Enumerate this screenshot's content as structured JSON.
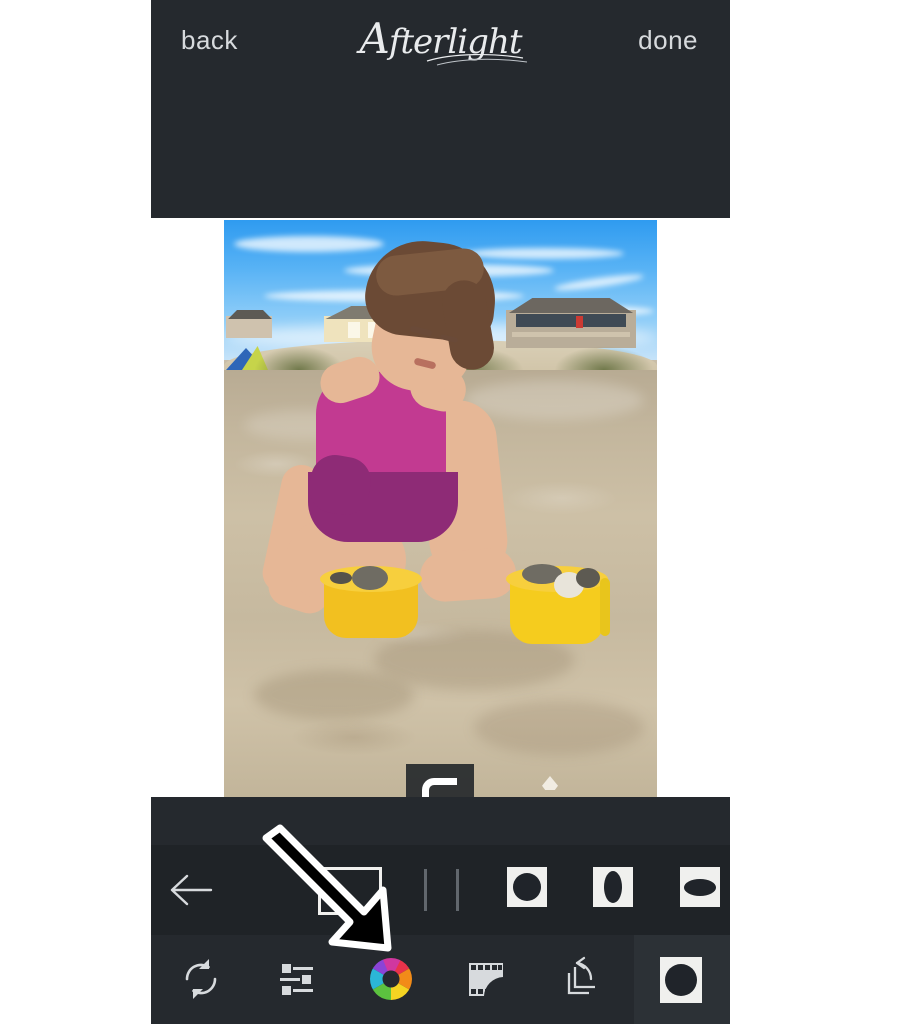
{
  "app": {
    "name": "Afterlight",
    "brand_cap": "A",
    "brand_rest": "fterlight"
  },
  "header": {
    "back_label": "back",
    "done_label": "done",
    "title": "Afterlight",
    "background_color": "#25292e",
    "text_color": "#d7dadd"
  },
  "photo": {
    "alt": "young girl in purple swimsuit crouching on wet sand beach with two yellow buckets of shells",
    "scene": {
      "sky": "blue sky with wispy white clouds",
      "background": "beach houses on dunes, blue and yellow tent at left",
      "subject": "girl with braided updo hair in magenta ruffled swimsuit",
      "foreground": "wet sand with two yellow sand buckets holding shells"
    }
  },
  "frame_preview": {
    "icon": "rounded-corner-frame-icon",
    "visible": true
  },
  "shape_row": {
    "back_icon": "arrow-left-icon",
    "items": [
      {
        "name": "rectangle-frame",
        "icon": "rectangle-outline-icon"
      },
      {
        "name": "bar-divider-1",
        "icon": "vertical-bar-icon"
      },
      {
        "name": "bar-divider-2",
        "icon": "vertical-bar-icon"
      },
      {
        "name": "circle-mask",
        "icon": "circle-in-square-icon"
      },
      {
        "name": "vertical-oval-mask",
        "icon": "vertical-oval-in-square-icon"
      },
      {
        "name": "horizontal-oval-mask",
        "icon": "horizontal-oval-in-square-icon"
      }
    ]
  },
  "tool_row": {
    "active": "frames",
    "items": [
      {
        "name": "reset",
        "icon": "refresh-icon"
      },
      {
        "name": "adjust",
        "icon": "sliders-icon"
      },
      {
        "name": "color",
        "icon": "color-wheel-icon"
      },
      {
        "name": "filters",
        "icon": "film-strip-icon"
      },
      {
        "name": "crop-rotate",
        "icon": "crop-rotate-icon"
      },
      {
        "name": "frames",
        "icon": "circle-in-square-icon"
      }
    ]
  },
  "annotation": {
    "arrow": "pointer-arrow-icon",
    "direction": "down-right"
  },
  "colors": {
    "panel": "#25292e",
    "panel_dark": "#1f2327",
    "panel_active": "#2c3136",
    "icon": "#d7dadd",
    "page_background": "#ffffff"
  }
}
